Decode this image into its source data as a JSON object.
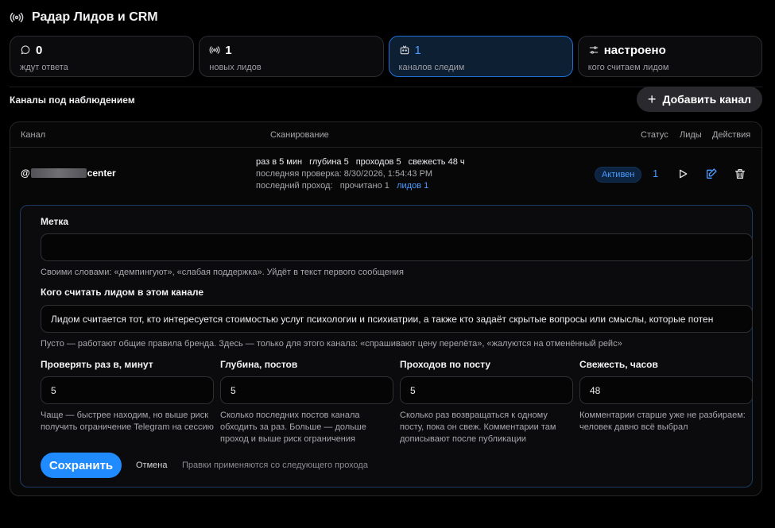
{
  "header": {
    "title": "Радар Лидов и CRM",
    "icon": "broadcast-icon"
  },
  "stats": [
    {
      "icon": "chat-icon",
      "value": "0",
      "label": "ждут ответа",
      "active": false
    },
    {
      "icon": "broadcast-icon",
      "value": "1",
      "label": "новых лидов",
      "active": false
    },
    {
      "icon": "channel-icon",
      "value": "1",
      "label": "каналов следим",
      "active": true
    },
    {
      "icon": "sliders-icon",
      "value": "настроено",
      "label": "кого считаем лидом",
      "active": false
    }
  ],
  "section": {
    "title": "Каналы под наблюдением",
    "add_button": "Добавить канал"
  },
  "table": {
    "columns": {
      "channel": "Канал",
      "scan": "Сканирование",
      "status": "Статус",
      "leads": "Лиды",
      "actions": "Действия"
    },
    "row": {
      "channel_prefix": "@",
      "channel_suffix": "center",
      "scan_interval": "раз в 5 мин",
      "scan_depth": "глубина 5",
      "scan_passes": "проходов 5",
      "scan_freshness": "свежесть 48 ч",
      "last_check": "последняя проверка: 8/30/2026, 1:54:43 PM",
      "last_pass_label": "последний проход:",
      "last_pass_read": "прочитано 1",
      "last_pass_leads": "лидов 1",
      "status": "Активен",
      "leads": "1"
    }
  },
  "form": {
    "label_title": "Метка",
    "label_value": "",
    "label_hint": "Своими словами: «демпингуют», «слабая поддержка». Уйдёт в текст первого сообщения",
    "lead_title": "Кого считать лидом в этом канале",
    "lead_value": "Лидом считается тот, кто интересуется стоимостью услуг психологии и психиатрии, а также кто задаёт скрытые вопросы или смыслы, которые потен",
    "lead_hint": "Пусто — работают общие правила бренда. Здесь — только для этого канала: «спрашивают цену перелёта», «жалуются на отменённый рейс»",
    "fields": [
      {
        "title": "Проверять раз в, минут",
        "value": "5",
        "hint": "Чаще — быстрее находим, но выше риск получить ограничение Telegram на сессию"
      },
      {
        "title": "Глубина, постов",
        "value": "5",
        "hint": "Сколько последних постов канала обходить за раз. Больше — дольше проход и выше риск ограничения"
      },
      {
        "title": "Проходов по посту",
        "value": "5",
        "hint": "Сколько раз возвращаться к одному посту, пока он свеж. Комментарии там дописывают после публикации"
      },
      {
        "title": "Свежесть, часов",
        "value": "48",
        "hint": "Комментарии старше уже не разбираем: человек давно всё выбрал"
      }
    ],
    "save": "Сохранить",
    "cancel": "Отмена",
    "apply_note": "Правки применяются со следующего прохода"
  },
  "colors": {
    "accent": "#1f8bff",
    "link": "#4a9bff",
    "active_bg": "#0d1f33"
  }
}
